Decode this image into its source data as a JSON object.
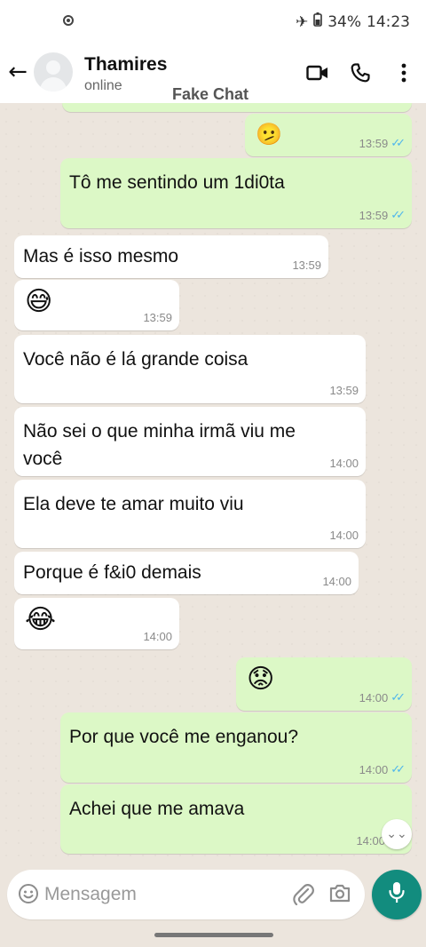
{
  "status_bar": {
    "battery": "34%",
    "time": "14:23",
    "icons": [
      "camera-dot-icon",
      "airplane-icon",
      "battery-icon"
    ]
  },
  "header": {
    "back_icon": "back-arrow-icon",
    "contact_name": "Thamires",
    "contact_status": "online",
    "watermark": "Fake Chat",
    "actions": [
      "video-call-icon",
      "phone-icon",
      "more-vert-icon"
    ]
  },
  "messages": [
    {
      "direction": "out",
      "kind": "emoji",
      "text": "🫤",
      "time": "13:59",
      "read": true
    },
    {
      "direction": "out",
      "kind": "text",
      "text": "Tô me sentindo um 1di0ta",
      "time": "13:59",
      "read": true
    },
    {
      "direction": "in",
      "kind": "text",
      "text": "Mas é isso mesmo",
      "time": "13:59"
    },
    {
      "direction": "in",
      "kind": "emoji",
      "text": "😅",
      "time": "13:59"
    },
    {
      "direction": "in",
      "kind": "text",
      "text": "Você não é lá grande coisa",
      "time": "13:59"
    },
    {
      "direction": "in",
      "kind": "text",
      "text": "Não sei o que minha irmã viu me\nvocê",
      "time": "14:00"
    },
    {
      "direction": "in",
      "kind": "text",
      "text": "Ela deve te amar muito viu",
      "time": "14:00"
    },
    {
      "direction": "in",
      "kind": "text",
      "text": "Porque é f&i0 demais",
      "time": "14:00"
    },
    {
      "direction": "in",
      "kind": "emoji",
      "text": "😂",
      "time": "14:00"
    },
    {
      "direction": "out",
      "kind": "emoji",
      "text": "😟",
      "time": "14:00",
      "read": true
    },
    {
      "direction": "out",
      "kind": "text",
      "text": "Por que você me enganou?",
      "time": "14:00",
      "read": true
    },
    {
      "direction": "out",
      "kind": "text",
      "text": "Achei que me amava",
      "time": "14:00"
    }
  ],
  "read_ticks": "✓✓",
  "scroll_down_icon": "chevron-double-down-icon",
  "scroll_down_glyph": "⌄⌄",
  "composer": {
    "placeholder": "Mensagem",
    "icons": [
      "emoji-icon",
      "attach-icon",
      "camera-icon"
    ],
    "send_icon": "mic-icon"
  },
  "colors": {
    "outgoing_bubble": "#dcf8c6",
    "incoming_bubble": "#ffffff",
    "accent": "#128c7e",
    "read_ticks": "#4fb6ec"
  }
}
